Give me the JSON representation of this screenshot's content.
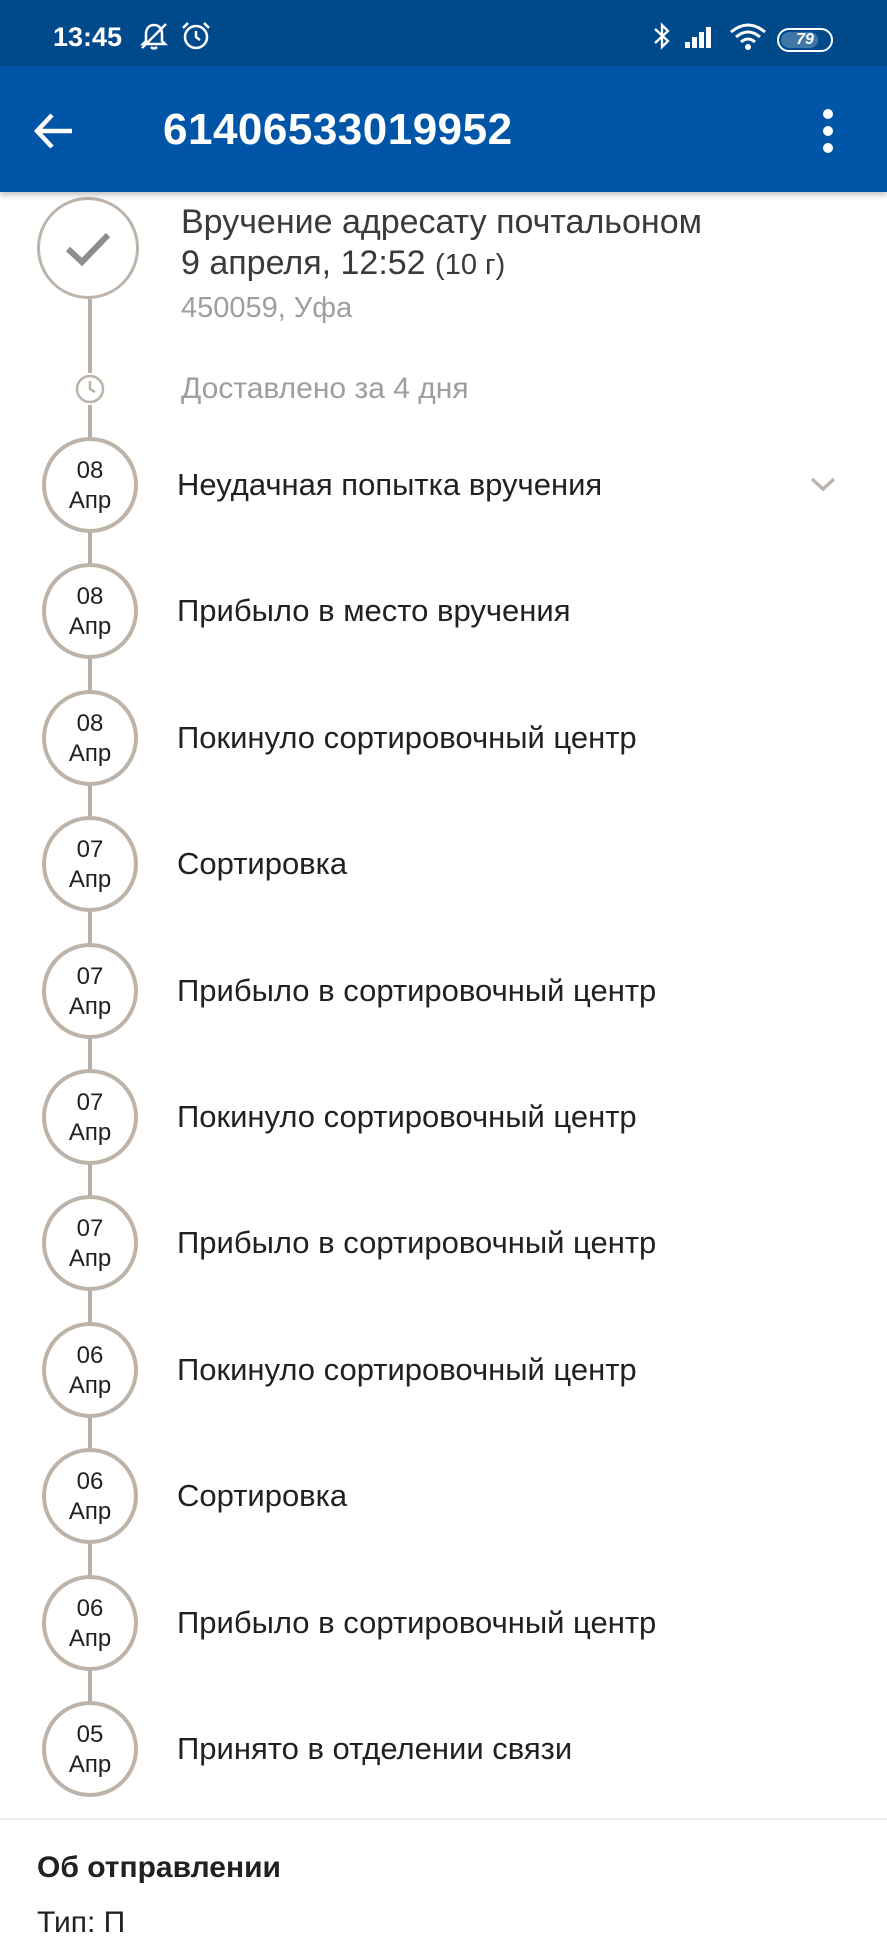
{
  "status_bar": {
    "time": "13:45",
    "icons": [
      "bell-off-icon",
      "alarm-icon",
      "bluetooth-icon",
      "signal-icon",
      "wifi-icon"
    ],
    "battery": "79",
    "battery_level": 0.79
  },
  "app_bar": {
    "title": "61406533019952",
    "back_icon": "arrow-left-icon",
    "menu_icon": "more-vert-icon"
  },
  "final_event": {
    "title": "Вручение адресату почтальоном",
    "datetime": "9 апреля, 12:52",
    "weight": "(10 г)",
    "place": "450059, Уфа",
    "icon": "check-icon"
  },
  "delivery_summary": "Доставлено за 4 дня",
  "events": [
    {
      "day": "08",
      "month": "Апр",
      "label": "Неудачная попытка вручения",
      "expandable": true
    },
    {
      "day": "08",
      "month": "Апр",
      "label": "Прибыло в место вручения"
    },
    {
      "day": "08",
      "month": "Апр",
      "label": "Покинуло сортировочный центр"
    },
    {
      "day": "07",
      "month": "Апр",
      "label": "Сортировка"
    },
    {
      "day": "07",
      "month": "Апр",
      "label": "Прибыло в сортировочный центр"
    },
    {
      "day": "07",
      "month": "Апр",
      "label": "Покинуло сортировочный центр"
    },
    {
      "day": "07",
      "month": "Апр",
      "label": "Прибыло в сортировочный центр"
    },
    {
      "day": "06",
      "month": "Апр",
      "label": "Покинуло сортировочный центр"
    },
    {
      "day": "06",
      "month": "Апр",
      "label": "Сортировка"
    },
    {
      "day": "06",
      "month": "Апр",
      "label": "Прибыло в сортировочный центр"
    },
    {
      "day": "05",
      "month": "Апр",
      "label": "Принято в отделении связи"
    }
  ],
  "about": {
    "title": "Об отправлении",
    "partial_text": "Тип: П"
  },
  "colors": {
    "status_bar": "#004a8c",
    "app_bar": "#0055a6",
    "timeline": "#bdb3a9"
  }
}
